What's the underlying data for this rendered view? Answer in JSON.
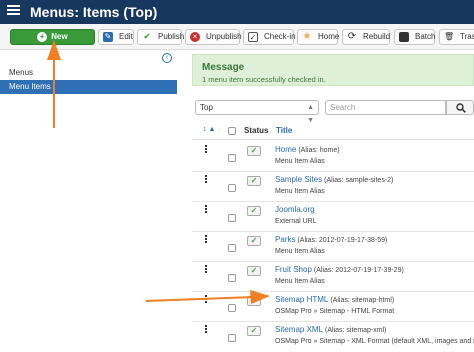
{
  "header": {
    "title": "Menus: Items (Top)"
  },
  "toolbar": {
    "buttons": [
      {
        "label": "New",
        "icon": "plus-circle-icon"
      },
      {
        "label": "Edit",
        "icon": "edit-icon"
      },
      {
        "label": "Publish",
        "icon": "check-icon"
      },
      {
        "label": "Unpublish",
        "icon": "close-circle-icon"
      },
      {
        "label": "Check-in",
        "icon": "checkbox-icon"
      },
      {
        "label": "Home",
        "icon": "star-icon"
      },
      {
        "label": "Rebuild",
        "icon": "refresh-icon"
      },
      {
        "label": "Batch",
        "icon": "batch-icon"
      },
      {
        "label": "Trash",
        "icon": "trash-icon"
      }
    ]
  },
  "sidebar": {
    "items": [
      {
        "label": "Menus"
      },
      {
        "label": "Menu Items",
        "active": true
      }
    ]
  },
  "message": {
    "title": "Message",
    "text": "1 menu item successfully checked in."
  },
  "filters": {
    "menu_select": "Top",
    "search_placeholder": "Search"
  },
  "table": {
    "headers": {
      "sort": "↕ ▲",
      "status": "Status",
      "title": "Title"
    },
    "rows": [
      {
        "title": "Home",
        "alias": "(Alias: home)",
        "type": "Menu Item Alias"
      },
      {
        "title": "Sample Sites",
        "alias": "(Alias: sample-sites-2)",
        "type": "Menu Item Alias"
      },
      {
        "title": "Joomla.org",
        "alias": "",
        "type": "External URL"
      },
      {
        "title": "Parks",
        "alias": "(Alias: 2012-07-19-17-38-59)",
        "type": "Menu Item Alias"
      },
      {
        "title": "Fruit Shop",
        "alias": "(Alias: 2012-07-19-17-39-29)",
        "type": "Menu Item Alias"
      },
      {
        "title": "Sitemap HTML",
        "alias": "(Alias: sitemap-html)",
        "type": "OSMap Pro » Sitemap - HTML Format"
      },
      {
        "title": "Sitemap XML",
        "alias": "(Alias: sitemap-xml)",
        "type": "OSMap Pro » Sitemap - XML Format (default XML, images and news)"
      }
    ]
  },
  "colors": {
    "header": "#17385e",
    "new_button": "#3a9a3a",
    "sidebar_active": "#2f6fb5",
    "link": "#2a6bb0",
    "arrow": "#f07f23",
    "message_bg": "#dff0d8"
  }
}
